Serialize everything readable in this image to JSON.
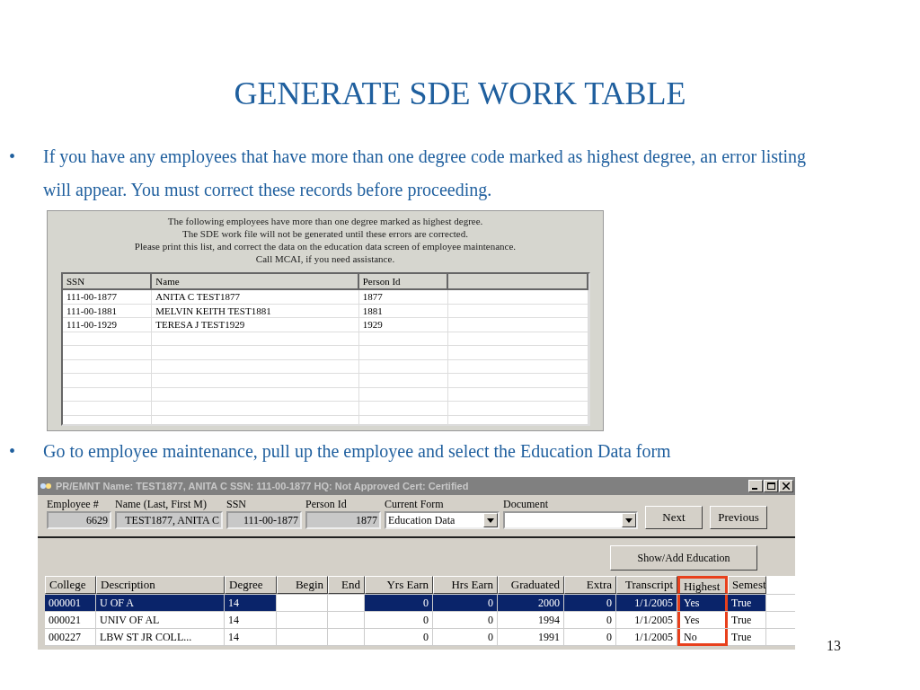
{
  "slide": {
    "title": "GENERATE SDE WORK TABLE",
    "page_number": "13"
  },
  "bullets": [
    {
      "marker": "•",
      "text": "If you have any employees that have more than one degree code marked as highest degree, an error listing will appear.  You must correct these records before proceeding."
    },
    {
      "marker": "•",
      "text": "Go to employee maintenance, pull up the employee and select the Education Data form"
    }
  ],
  "error_dialog": {
    "message": [
      "The following employees have more than one degree marked as highest degree.",
      "The SDE work file will not be generated until these errors are corrected.",
      "Please print this list, and correct the data on the education data screen of employee maintenance.",
      "Call MCAI, if you need assistance."
    ],
    "columns": [
      "SSN",
      "Name",
      "Person Id"
    ],
    "rows": [
      [
        "111-00-1877",
        "ANITA C TEST1877",
        "1877"
      ],
      [
        "111-00-1881",
        "MELVIN KEITH TEST1881",
        "1881"
      ],
      [
        "111-00-1929",
        "TERESA J TEST1929",
        "1929"
      ]
    ]
  },
  "employee_window": {
    "title": "PR/EMNT  Name: TEST1877, ANITA C SSN: 111-00-1877 HQ: Not Approved Cert: Certified",
    "fields": [
      {
        "label": "Employee #",
        "value": "6629",
        "kind": "readonly"
      },
      {
        "label": "Name (Last, First M)",
        "value": "TEST1877, ANITA C",
        "kind": "readonly"
      },
      {
        "label": "SSN",
        "value": "111-00-1877",
        "kind": "readonly"
      },
      {
        "label": "Person Id",
        "value": "1877",
        "kind": "readonly"
      },
      {
        "label": "Current Form",
        "value": "Education Data",
        "kind": "dropdown"
      },
      {
        "label": "Document",
        "kind": "dropdown"
      }
    ],
    "buttons": [
      "Next",
      "Previous"
    ],
    "show_add_button": "Show/Add Education",
    "columns": [
      {
        "label": "College",
        "highlighted": false
      },
      {
        "label": "Description",
        "highlighted": false
      },
      {
        "label": "Degree",
        "highlighted": false
      },
      {
        "label": "Begin",
        "highlighted": false
      },
      {
        "label": "End",
        "highlighted": false
      },
      {
        "label": "Yrs Earn",
        "highlighted": false
      },
      {
        "label": "Hrs Earn",
        "highlighted": false
      },
      {
        "label": "Graduated",
        "highlighted": false
      },
      {
        "label": "Extra",
        "highlighted": false
      },
      {
        "label": "Transcript",
        "highlighted": false
      },
      {
        "label": "Highest",
        "highlighted": true
      },
      {
        "label": "Semest",
        "highlighted": false
      }
    ],
    "rows": [
      {
        "selected": true,
        "cells": [
          "000001",
          "U OF A",
          "14",
          "",
          "",
          "0",
          "0",
          "2000",
          "0",
          "1/1/2005",
          "Yes",
          "True"
        ]
      },
      {
        "selected": false,
        "cells": [
          "000021",
          "UNIV OF AL",
          "14",
          "",
          "",
          "0",
          "0",
          "1994",
          "0",
          "1/1/2005",
          "Yes",
          "True"
        ]
      },
      {
        "selected": false,
        "cells": [
          "000227",
          "LBW ST JR COLL...",
          "14",
          "",
          "",
          "0",
          "0",
          "1991",
          "0",
          "1/1/2005",
          "No",
          "True"
        ]
      }
    ]
  }
}
